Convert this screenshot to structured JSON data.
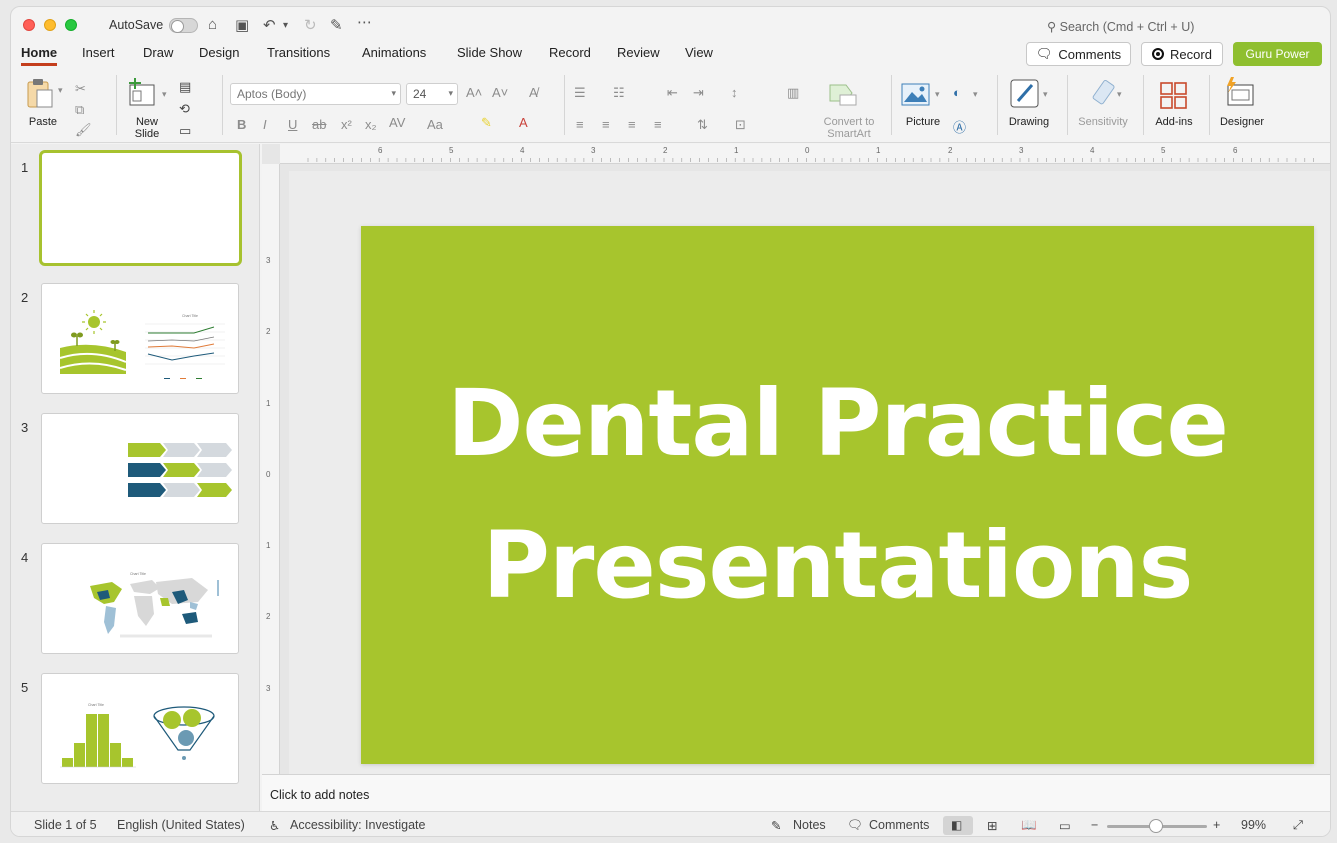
{
  "titlebar": {
    "autosave_label": "AutoSave",
    "search_placeholder": "Search (Cmd + Ctrl + U)"
  },
  "tabs": [
    {
      "label": "Home",
      "active": true
    },
    {
      "label": "Insert"
    },
    {
      "label": "Draw"
    },
    {
      "label": "Design"
    },
    {
      "label": "Transitions"
    },
    {
      "label": "Animations"
    },
    {
      "label": "Slide Show"
    },
    {
      "label": "Record"
    },
    {
      "label": "Review"
    },
    {
      "label": "View"
    }
  ],
  "header_buttons": {
    "comments": "Comments",
    "record": "Record",
    "guru": "Guru Power"
  },
  "ribbon": {
    "paste": "Paste",
    "new_slide_line1": "New",
    "new_slide_line2": "Slide",
    "font_name": "Aptos (Body)",
    "font_size": "24",
    "convert_line1": "Convert to",
    "convert_line2": "SmartArt",
    "picture": "Picture",
    "drawing": "Drawing",
    "sensitivity": "Sensitivity",
    "addins": "Add-ins",
    "designer": "Designer"
  },
  "thumbnails": [
    {
      "number": "1"
    },
    {
      "number": "2",
      "chart_title": "Chart Title"
    },
    {
      "number": "3"
    },
    {
      "number": "4",
      "chart_title": "Chart Title"
    },
    {
      "number": "5",
      "chart_title": "Chart Title"
    }
  ],
  "slide": {
    "title_line1": "Dental Practice",
    "title_line2": "Presentations",
    "background": "#a7c52d"
  },
  "rulers": {
    "h_ticks": [
      "6",
      "5",
      "4",
      "3",
      "2",
      "1",
      "0",
      "1",
      "2",
      "3",
      "4",
      "5",
      "6"
    ],
    "v_ticks": [
      "3",
      "2",
      "1",
      "0",
      "1",
      "2",
      "3"
    ]
  },
  "notes_placeholder": "Click to add notes",
  "status": {
    "slide_count": "Slide 1 of 5",
    "language": "English (United States)",
    "accessibility": "Accessibility: Investigate",
    "notes": "Notes",
    "comments": "Comments",
    "zoom": "99%"
  },
  "colors": {
    "accent_green": "#a7c52d",
    "tab_underline": "#c43e1c",
    "guru_button": "#8fbf2f",
    "dark_blue": "#1e5a7a"
  }
}
